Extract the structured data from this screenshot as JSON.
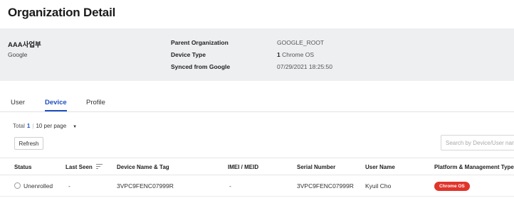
{
  "page": {
    "title": "Organization Detail"
  },
  "organization": {
    "name": "AAA사업부",
    "domain": "Google",
    "details": [
      {
        "label": "Parent Organization",
        "value": "GOOGLE_ROOT"
      },
      {
        "label": "Device Type",
        "value_count": "1",
        "value_text": "Chrome OS"
      },
      {
        "label": "Synced from Google",
        "value": "07/29/2021 18:25:50"
      }
    ]
  },
  "tabs": [
    {
      "label": "User",
      "active": false
    },
    {
      "label": "Device",
      "active": true
    },
    {
      "label": "Profile",
      "active": false
    }
  ],
  "list": {
    "total_label": "Total",
    "total_count": "1",
    "separator": "|",
    "per_page": "10 per page",
    "refresh_label": "Refresh",
    "search_placeholder": "Search by Device/User name"
  },
  "table": {
    "columns": [
      "Status",
      "Last Seen",
      "Device Name & Tag",
      "IMEI / MEID",
      "Serial Number",
      "User Name",
      "Platform & Management Type"
    ],
    "rows": [
      {
        "status": "Unenrolled",
        "last_seen": "-",
        "device_name": "3VPC9FENC07999R",
        "imei": "-",
        "serial": "3VPC9FENC07999R",
        "user": "Kyuil Cho",
        "platform": "Chrome OS"
      }
    ]
  },
  "colors": {
    "accent": "#1e4fc2",
    "panel_bg": "#eeeff1",
    "badge_red": "#e0352b"
  }
}
